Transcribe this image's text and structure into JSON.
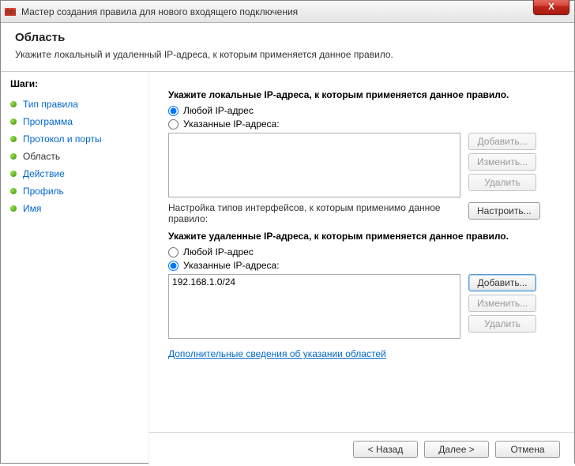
{
  "window": {
    "title": "Мастер создания правила для нового входящего подключения",
    "close_label": "X"
  },
  "header": {
    "title": "Область",
    "subtitle": "Укажите локальный и удаленный IP-адреса, к которым применяется данное правило."
  },
  "sidebar": {
    "title": "Шаги:",
    "steps": [
      {
        "label": "Тип правила",
        "current": false
      },
      {
        "label": "Программа",
        "current": false
      },
      {
        "label": "Протокол и порты",
        "current": false
      },
      {
        "label": "Область",
        "current": true
      },
      {
        "label": "Действие",
        "current": false
      },
      {
        "label": "Профиль",
        "current": false
      },
      {
        "label": "Имя",
        "current": false
      }
    ]
  },
  "main": {
    "local": {
      "title": "Укажите локальные IP-адреса, к которым применяется данное правило.",
      "radio_any": "Любой IP-адрес",
      "radio_specified": "Указанные IP-адреса:",
      "selected": "any",
      "items": [],
      "buttons": {
        "add": "Добавить...",
        "edit": "Изменить...",
        "remove": "Удалить"
      }
    },
    "interfaces": {
      "text": "Настройка типов интерфейсов, к которым применимо данное правило:",
      "button": "Настроить..."
    },
    "remote": {
      "title": "Укажите удаленные IP-адреса, к которым применяется данное правило.",
      "radio_any": "Любой IP-адрес",
      "radio_specified": "Указанные IP-адреса:",
      "selected": "specified",
      "items": [
        "192.168.1.0/24"
      ],
      "buttons": {
        "add": "Добавить...",
        "edit": "Изменить...",
        "remove": "Удалить"
      }
    },
    "link": "Дополнительные сведения об указании областей"
  },
  "footer": {
    "back": "< Назад",
    "next": "Далее >",
    "cancel": "Отмена"
  }
}
